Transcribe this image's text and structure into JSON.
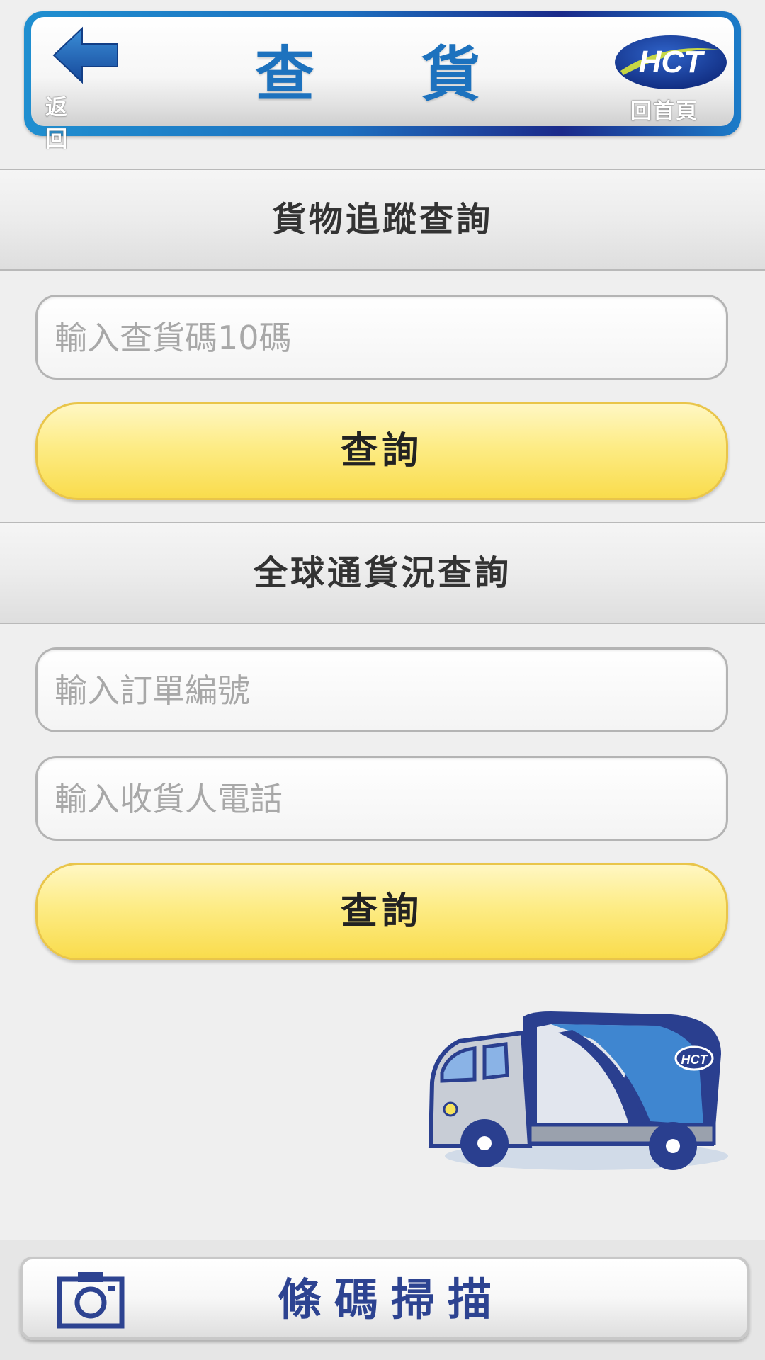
{
  "header": {
    "back_label": "返回",
    "title": "查貨",
    "home_label": "回首頁",
    "logo_text": "HCT"
  },
  "tracking": {
    "section_title": "貨物追蹤查詢",
    "code_placeholder": "輸入查貨碼10碼",
    "query_label": "查詢"
  },
  "global": {
    "section_title": "全球通貨況查詢",
    "order_placeholder": "輸入訂單編號",
    "phone_placeholder": "輸入收貨人電話",
    "query_label": "查詢"
  },
  "truck_logo_text": "HCT",
  "scan": {
    "label": "條碼掃描"
  },
  "colors": {
    "brand_blue": "#1d72be",
    "navy": "#2d4391",
    "button_yellow": "#f9dc4c"
  }
}
